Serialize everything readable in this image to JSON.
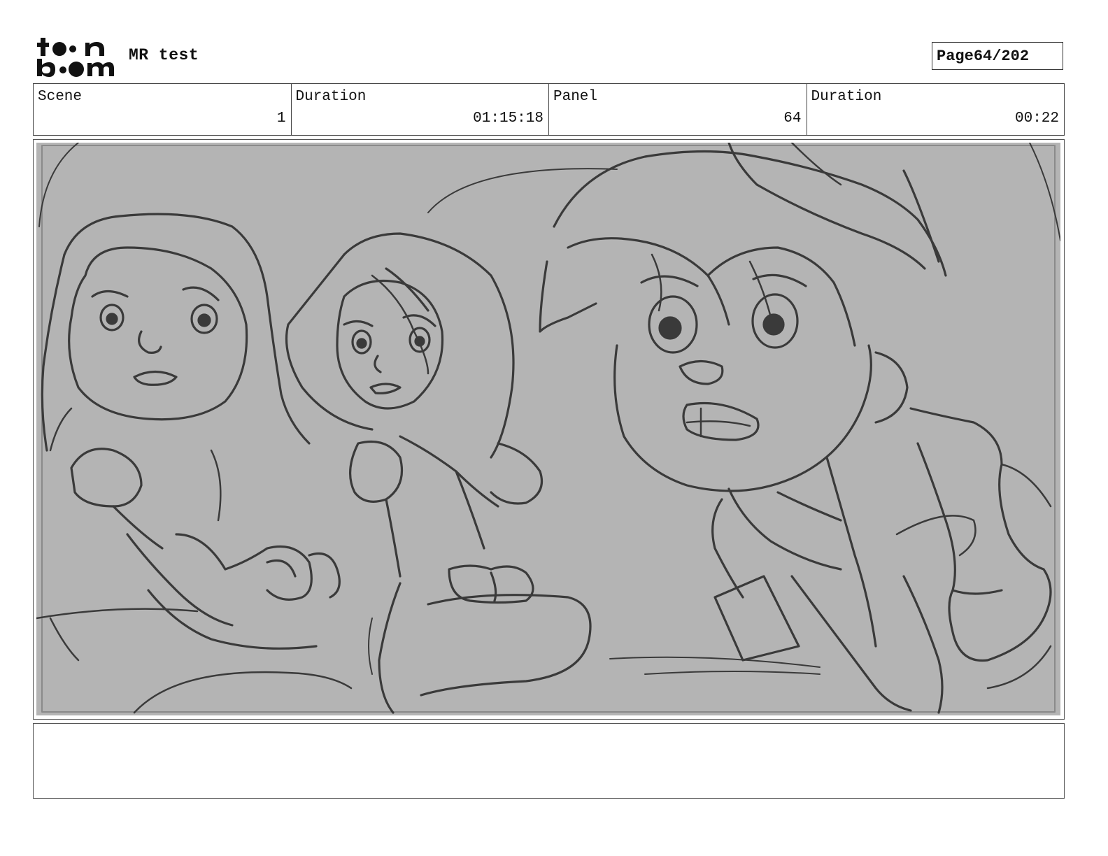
{
  "header": {
    "project_title": "MR test",
    "page_label": "Page",
    "page_number": "64/202"
  },
  "info_bar": [
    {
      "label": "Scene",
      "value": "1"
    },
    {
      "label": "Duration",
      "value": "01:15:18"
    },
    {
      "label": "Panel",
      "value": "64"
    },
    {
      "label": "Duration",
      "value": "00:22"
    }
  ],
  "colors": {
    "panel_background": "#b4b4b4",
    "sketch_line": "#3a3a3a"
  },
  "icons": {
    "logo": "toonboom-logo-icon"
  }
}
